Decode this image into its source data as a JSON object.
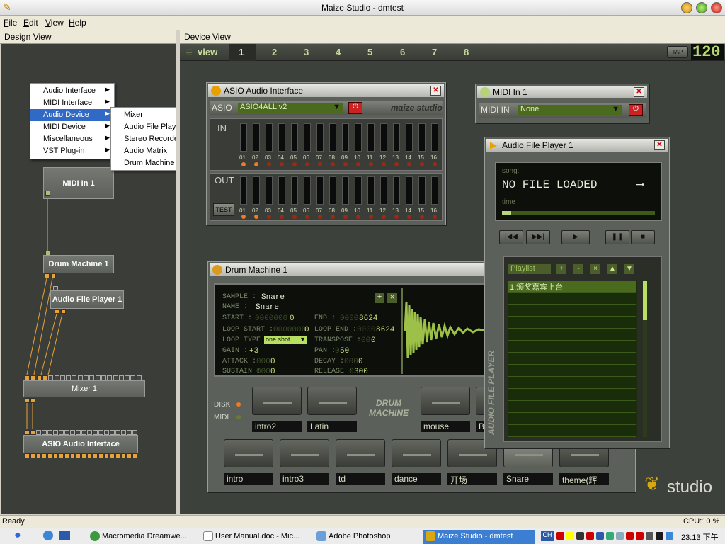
{
  "window": {
    "title": "Maize Studio - dmtest"
  },
  "menu": [
    "File",
    "Edit",
    "View",
    "Help"
  ],
  "panes": {
    "design": "Design View",
    "device": "Device View"
  },
  "device_tabs": {
    "view": "view",
    "pages": [
      "1",
      "2",
      "3",
      "4",
      "5",
      "6",
      "7",
      "8"
    ],
    "active": "1",
    "tap": "TAP",
    "tempo": "120"
  },
  "context_menu": {
    "items": [
      "Audio Interface",
      "MIDI Interface",
      "Audio Device",
      "MIDI Device",
      "Miscellaneous",
      "VST Plug-in"
    ],
    "selected": "Audio Device",
    "submenu": [
      "Mixer",
      "Audio File Player",
      "Stereo Recorder",
      "Audio Matrix",
      "Drum Machine"
    ]
  },
  "design_nodes": {
    "midi_in": "MIDI In 1",
    "drum_machine": "Drum Machine 1",
    "audio_file_player": "Audio File Player 1",
    "mixer": "Mixer 1",
    "asio": "ASIO Audio Interface"
  },
  "asio": {
    "title": "ASIO Audio Interface",
    "label": "ASIO",
    "driver": "ASIO4ALL v2",
    "brand": "maize studio",
    "in_label": "IN",
    "out_label": "OUT",
    "test_label": "TEST",
    "channels": [
      "01",
      "02",
      "03",
      "04",
      "05",
      "06",
      "07",
      "08",
      "09",
      "10",
      "11",
      "12",
      "13",
      "14",
      "15",
      "16"
    ]
  },
  "midi_in": {
    "title": "MIDI In 1",
    "label": "MIDI IN",
    "device": "None"
  },
  "player": {
    "title": "Audio File Player 1",
    "song_label": "song:",
    "song": "NO FILE LOADED",
    "time_label": "time",
    "playlist_label": "Playlist",
    "playlist_buttons": [
      "+",
      "-",
      "×",
      "▲",
      "▼"
    ],
    "playlist_items": [
      "1.颁奖嘉宾上台"
    ],
    "side_label": "AUDIO FILE PLAYER",
    "transport": [
      "|◀◀",
      "▶▶|",
      "▶",
      "❚❚",
      "■"
    ]
  },
  "drum": {
    "title": "Drum Machine 1",
    "sample_label": "SAMPLE :",
    "sample": "Snare",
    "name_label": "NAME :",
    "name": "Snare",
    "start_label": "START :",
    "start_dim": "0000000",
    "start": "0",
    "end_label": "END :",
    "end_dim": "0000",
    "end": "8624",
    "loop_start_label": "LOOP START :",
    "loop_start_dim": "0000000",
    "loop_start": "0",
    "loop_end_label": "LOOP END :",
    "loop_end_dim": "0000",
    "loop_end": "8624",
    "loop_type_label": "LOOP TYPE :",
    "loop_type": "one shot",
    "transpose_label": "TRANSPOSE :",
    "transpose_dim": "00",
    "transpose": "0",
    "gain_label": "GAIN :",
    "gain": "+3",
    "pan_label": "PAN :",
    "pan_dim": "0",
    "pan": "50",
    "attack_label": "ATTACK :",
    "attack_dim": "000",
    "attack": "0",
    "decay_label": "DECAY :",
    "decay_dim": "000",
    "decay": "0",
    "sustain_label": "SUSTAIN :",
    "sustain_dim": "000",
    "sustain": "0",
    "release_label": "RELEASE :",
    "release_dim": "0",
    "release": "300",
    "disk_label": "DISK",
    "midi_label": "MIDI",
    "logo": "DRUM MACHINE",
    "pads_top": [
      "intro2",
      "Latin",
      "",
      "mouse",
      "B"
    ],
    "pads_bottom": [
      "intro",
      "intro3",
      "td",
      "dance",
      "开场",
      "Snare",
      "theme(辉"
    ]
  },
  "brand_logo": "studio",
  "status": {
    "left": "Ready",
    "right": "CPU:10 %"
  },
  "taskbar": {
    "tasks": [
      "Macromedia Dreamwe...",
      "User Manual.doc - Mic...",
      "Adobe Photoshop",
      "Maize Studio - dmtest"
    ],
    "tray_lang": "CH",
    "clock": "23:13 下午"
  },
  "colors": {
    "accent": "#b9d67a",
    "port": "#e8a23a",
    "bg": "#3d413b",
    "selection": "#316ac5"
  }
}
